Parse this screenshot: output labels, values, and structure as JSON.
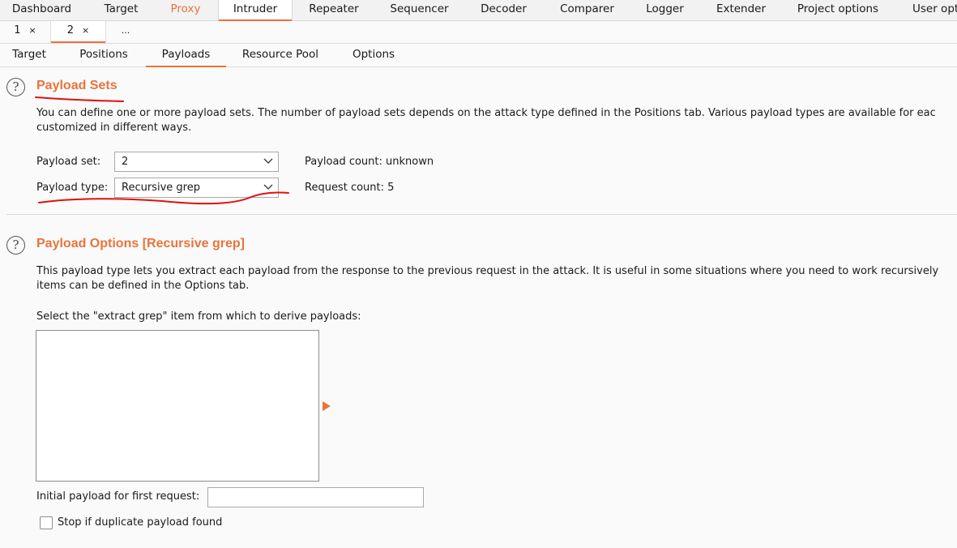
{
  "main_tabs": [
    {
      "label": "Dashboard"
    },
    {
      "label": "Target"
    },
    {
      "label": "Proxy"
    },
    {
      "label": "Intruder"
    },
    {
      "label": "Repeater"
    },
    {
      "label": "Sequencer"
    },
    {
      "label": "Decoder"
    },
    {
      "label": "Comparer"
    },
    {
      "label": "Logger"
    },
    {
      "label": "Extender"
    },
    {
      "label": "Project options"
    },
    {
      "label": "User opt"
    }
  ],
  "instance_tabs": [
    {
      "label": "1",
      "close": "×"
    },
    {
      "label": "2",
      "close": "×"
    },
    {
      "label": "..."
    }
  ],
  "sub_tabs": [
    {
      "label": "Target"
    },
    {
      "label": "Positions"
    },
    {
      "label": "Payloads"
    },
    {
      "label": "Resource Pool"
    },
    {
      "label": "Options"
    }
  ],
  "payload_sets": {
    "help": "?",
    "title": "Payload Sets",
    "desc_line1": "You can define one or more payload sets. The number of payload sets depends on the attack type defined in the Positions tab. Various payload types are available for eac",
    "desc_line2": "customized in different ways.",
    "set_label": "Payload set:",
    "set_value": "2",
    "type_label": "Payload type:",
    "type_value": "Recursive grep",
    "payload_count": "Payload count: unknown",
    "request_count": "Request count: 5"
  },
  "payload_options": {
    "help": "?",
    "title": "Payload Options [Recursive grep]",
    "desc_line1": "This payload type lets you extract each payload from the response to the previous request in the attack. It is useful in some situations where you need to work recursively",
    "desc_line2": "items can be defined in the Options tab.",
    "select_label": "Select the \"extract grep\" item from which to derive payloads:",
    "initial_label": "Initial payload for first request:",
    "initial_value": "",
    "stop_label": "Stop if duplicate payload found",
    "stop_checked": false
  },
  "colors": {
    "accent": "#e8743b",
    "annotation_red": "#e01010"
  }
}
